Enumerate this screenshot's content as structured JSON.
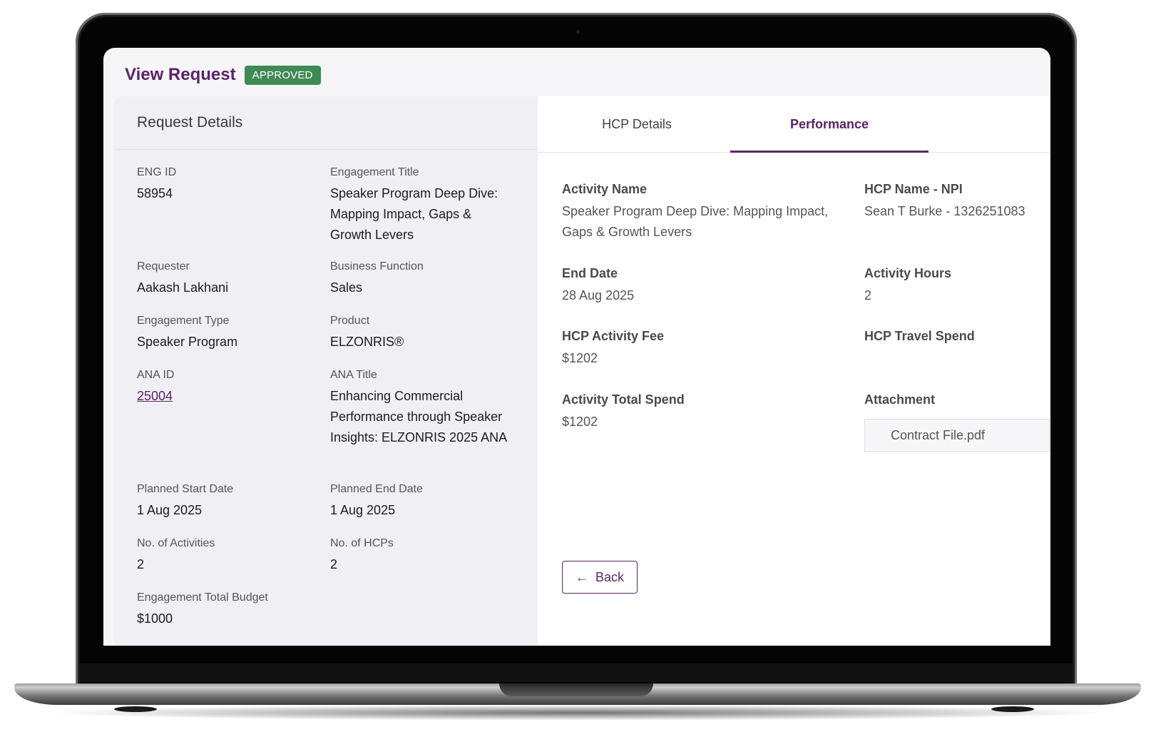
{
  "header": {
    "title": "View Request",
    "status": "APPROVED"
  },
  "request_details": {
    "title": "Request Details",
    "fields": {
      "eng_id": {
        "label": "ENG ID",
        "value": "58954"
      },
      "engagement_title": {
        "label": "Engagement Title",
        "value": "Speaker Program Deep Dive: Mapping Impact, Gaps & Growth Levers"
      },
      "requester": {
        "label": "Requester",
        "value": "Aakash Lakhani"
      },
      "business_function": {
        "label": "Business Function",
        "value": "Sales"
      },
      "engagement_type": {
        "label": "Engagement Type",
        "value": "Speaker Program"
      },
      "product": {
        "label": "Product",
        "value": "ELZONRIS®"
      },
      "ana_id": {
        "label": "ANA ID",
        "value": "25004"
      },
      "ana_title": {
        "label": "ANA Title",
        "value": "Enhancing Commercial Performance through Speaker Insights: ELZONRIS 2025 ANA"
      },
      "planned_start_date": {
        "label": "Planned Start Date",
        "value": "1 Aug 2025"
      },
      "planned_end_date": {
        "label": "Planned End Date",
        "value": "1 Aug 2025"
      },
      "num_activities": {
        "label": "No. of Activities",
        "value": "2"
      },
      "num_hcps": {
        "label": "No. of HCPs",
        "value": "2"
      },
      "total_budget": {
        "label": "Engagement Total Budget",
        "value": "$1000"
      }
    }
  },
  "tabs": [
    {
      "label": "HCP Details",
      "active": false
    },
    {
      "label": "Performance",
      "active": true
    }
  ],
  "performance": {
    "activity_name": {
      "label": "Activity Name",
      "value": "Speaker Program Deep Dive: Mapping Impact, Gaps & Growth Levers"
    },
    "hcp_name_npi": {
      "label": "HCP Name - NPI",
      "value": "Sean T Burke - 1326251083"
    },
    "end_date": {
      "label": "End Date",
      "value": "28 Aug 2025"
    },
    "activity_hours": {
      "label": "Activity Hours",
      "value": "2"
    },
    "hcp_activity_fee": {
      "label": "HCP Activity Fee",
      "value": "$1202"
    },
    "hcp_travel_spend": {
      "label": "HCP Travel Spend",
      "value": ""
    },
    "activity_total_spend": {
      "label": "Activity Total Spend",
      "value": "$1202"
    },
    "attachment": {
      "label": "Attachment",
      "value": "Contract File.pdf"
    }
  },
  "actions": {
    "back_label": "Back",
    "back_icon": "arrow-left-icon"
  },
  "colors": {
    "brand": "#5a2467",
    "approved": "#3f8a55"
  }
}
